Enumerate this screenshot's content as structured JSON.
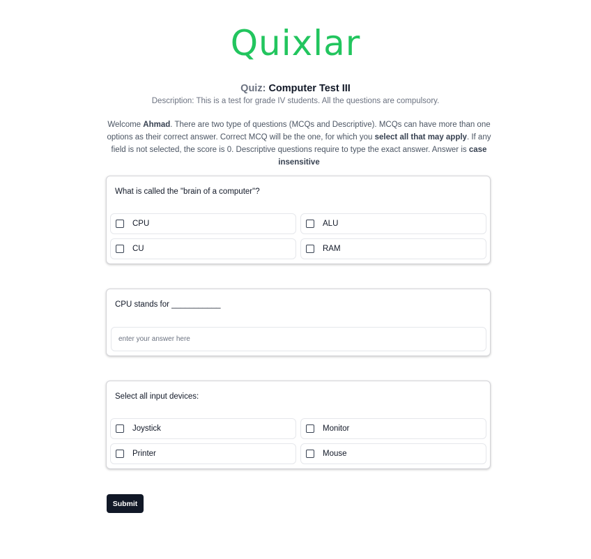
{
  "logo": "Quixlar",
  "quiz": {
    "prefix": "Quiz:",
    "name": "Computer Test III",
    "description": "Description: This is a test for grade IV students. All the questions are compulsory."
  },
  "welcome": {
    "pre_name": "Welcome ",
    "user": "Ahmad",
    "text1": ". There are two type of questions (MCQs and Descriptive). MCQs can have more than one options as their correct answer. Correct MCQ will be the one, for which you ",
    "bold1": "select all that may apply",
    "text2": ". If any field is not selected, the score is 0. Descriptive questions require to type the exact answer. Answer is ",
    "bold2": "case insensitive"
  },
  "questions": [
    {
      "text": "What is called the \"brain of a computer\"?",
      "options": [
        "CPU",
        "ALU",
        "CU",
        "RAM"
      ]
    },
    {
      "text": "CPU stands for ___________",
      "placeholder": "enter your answer here"
    },
    {
      "text": "Select all input devices:",
      "options": [
        "Joystick",
        "Monitor",
        "Printer",
        "Mouse"
      ]
    }
  ],
  "submit_label": "Submit"
}
